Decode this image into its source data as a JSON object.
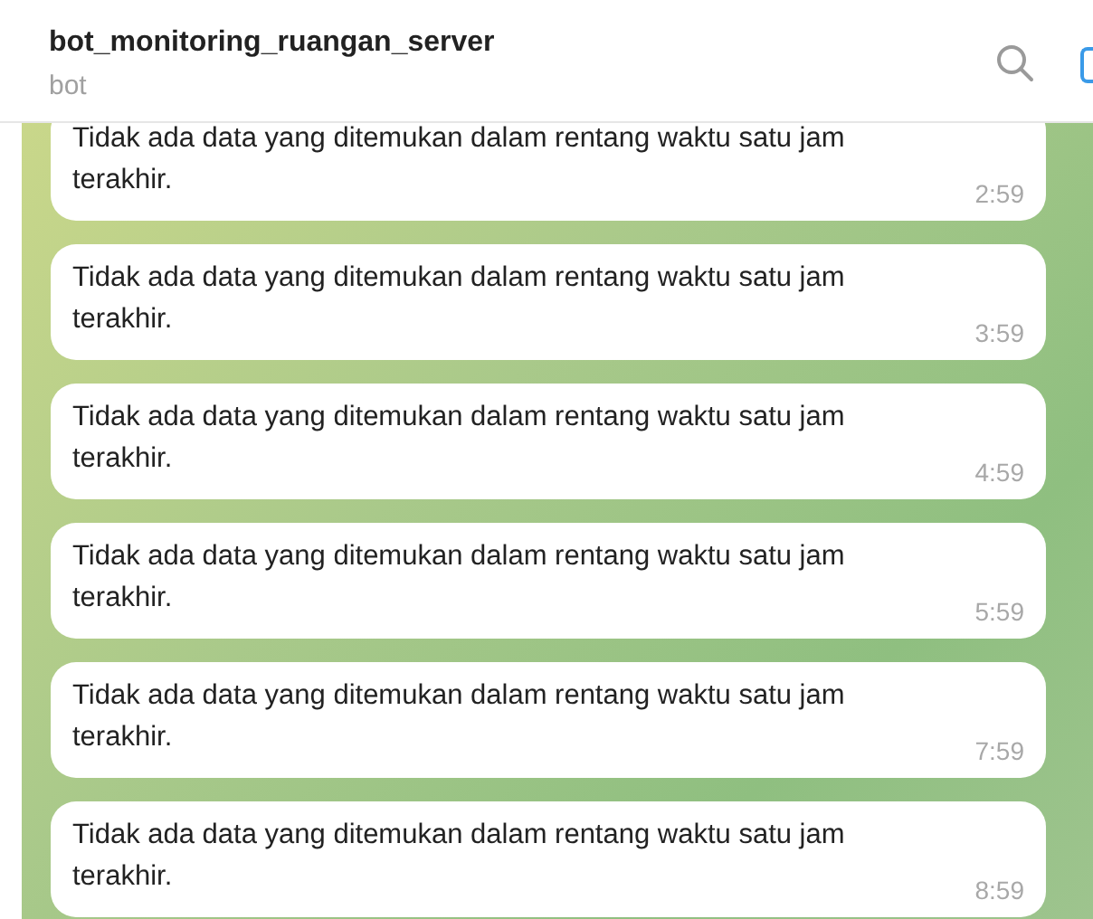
{
  "header": {
    "title": "bot_monitoring_ruangan_server",
    "subtitle": "bot"
  },
  "messages": [
    {
      "text": "Tidak ada data yang ditemukan dalam rentang waktu satu jam terakhir.",
      "time": "2:59"
    },
    {
      "text": "Tidak ada data yang ditemukan dalam rentang waktu satu jam terakhir.",
      "time": "3:59"
    },
    {
      "text": "Tidak ada data yang ditemukan dalam rentang waktu satu jam terakhir.",
      "time": "4:59"
    },
    {
      "text": "Tidak ada data yang ditemukan dalam rentang waktu satu jam terakhir.",
      "time": "5:59"
    },
    {
      "text": "Tidak ada data yang ditemukan dalam rentang waktu satu jam terakhir.",
      "time": "7:59"
    },
    {
      "text": "Tidak ada data yang ditemukan dalam rentang waktu satu jam terakhir.",
      "time": "8:59"
    }
  ]
}
